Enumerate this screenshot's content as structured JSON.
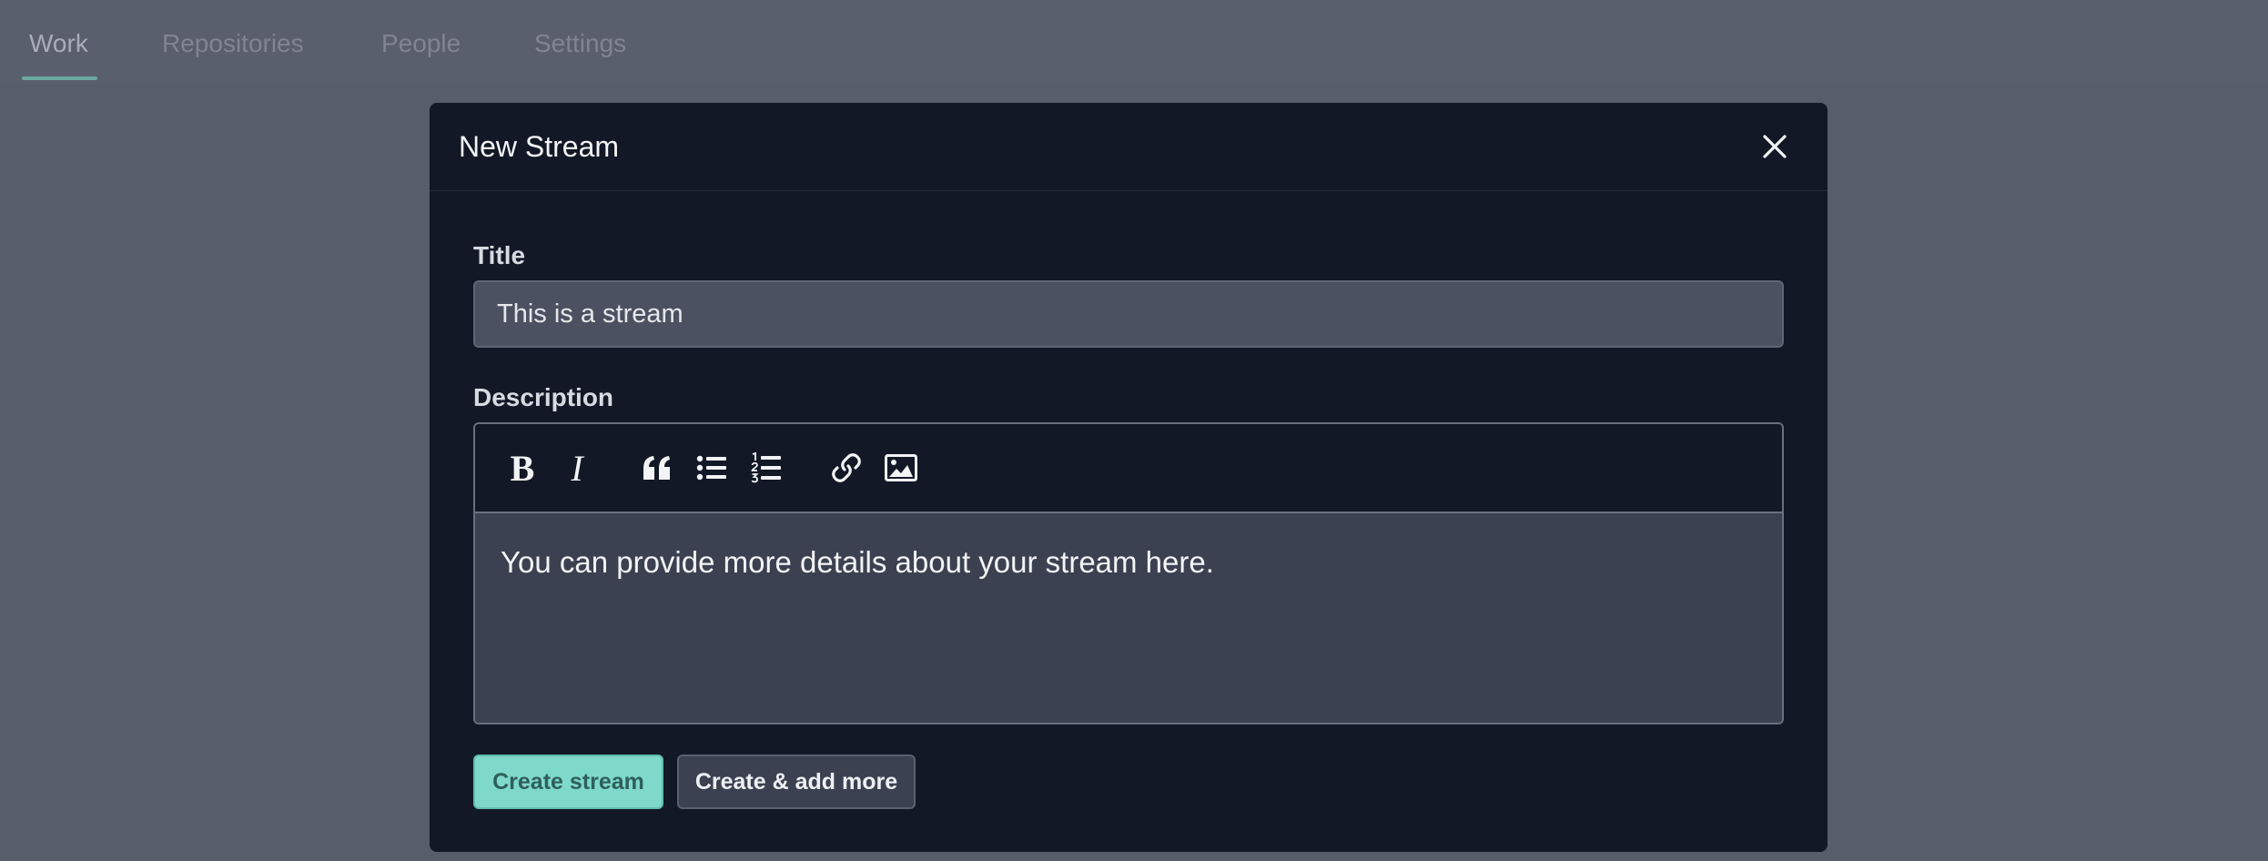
{
  "nav": {
    "tabs": [
      {
        "label": "Work",
        "active": true
      },
      {
        "label": "Repositories",
        "active": false
      },
      {
        "label": "People",
        "active": false
      },
      {
        "label": "Settings",
        "active": false
      }
    ]
  },
  "modal": {
    "title": "New Stream",
    "close_icon": "close-icon",
    "title_field": {
      "label": "Title",
      "value": "This is a stream"
    },
    "description_field": {
      "label": "Description",
      "toolbar": {
        "bold_glyph": "B",
        "italic_glyph": "I",
        "icons": [
          "bold-icon",
          "italic-icon",
          "quote-icon",
          "bullet-list-icon",
          "numbered-list-icon",
          "link-icon",
          "image-icon"
        ]
      },
      "value": "You can provide more details about your stream here."
    },
    "buttons": {
      "create": "Create stream",
      "create_more": "Create & add more"
    }
  },
  "colors": {
    "accent": "#7ed9cb",
    "modal_bg": "#121826",
    "overlay_bg": "#585d6c"
  }
}
